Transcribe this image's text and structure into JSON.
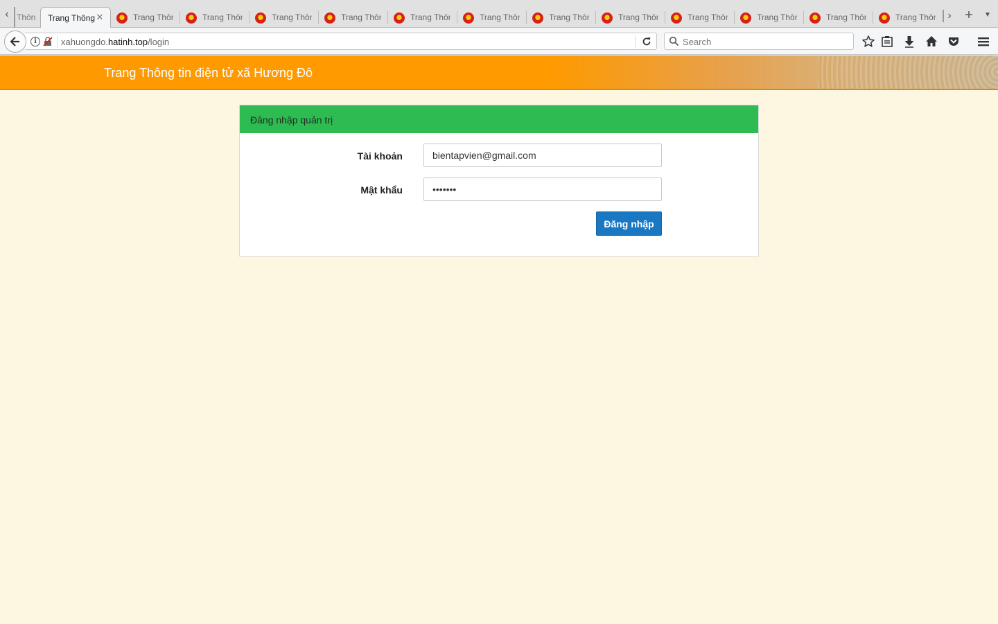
{
  "browser": {
    "partial_tab_title": "Thôn",
    "active_tab_title": "Trang Thông",
    "tabs": [
      {
        "title": "Trang Thôn"
      },
      {
        "title": "Trang Thôn"
      },
      {
        "title": "Trang Thôn"
      },
      {
        "title": "Trang Thôn"
      },
      {
        "title": "Trang Thôn"
      },
      {
        "title": "Trang Thôn"
      },
      {
        "title": "Trang Thôn"
      },
      {
        "title": "Trang Thôn"
      },
      {
        "title": "Trang Thôn"
      },
      {
        "title": "Trang Thôn"
      },
      {
        "title": "Trang Thôn"
      },
      {
        "title": "Trang Thôn"
      }
    ],
    "url_prefix": "xahuongdo.",
    "url_host": "hatinh.top",
    "url_path": "/login",
    "search_placeholder": "Search",
    "toolbar_icons": [
      "bookmark-star-icon",
      "reading-list-icon",
      "download-icon",
      "home-icon",
      "pocket-icon",
      "menu-icon"
    ]
  },
  "site": {
    "title": "Trang Thông tin điện tử xã Hương Đô",
    "header_color": "#ff9900"
  },
  "login": {
    "heading": "Đăng nhập quản trị",
    "heading_color": "#2dbb52",
    "username_label": "Tài khoản",
    "username_value": "bientapvien@gmail.com",
    "password_label": "Mật khẩu",
    "password_value": "1234567",
    "submit_label": "Đăng nhập",
    "submit_color": "#1a78c2"
  }
}
